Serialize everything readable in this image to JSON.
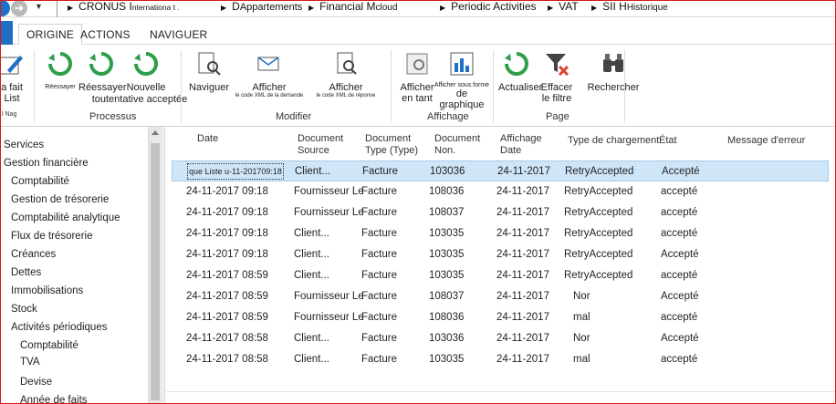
{
  "breadcrumb": {
    "company": "CRONUS I",
    "company_small": "nternationa t .",
    "dept": "D",
    "dept_small": "Appartements",
    "area": "Financial M",
    "area_small": "cloud",
    "periodic": "Periodic Activities",
    "vat": "VAT",
    "last": "SII H",
    "last_small": "Historique"
  },
  "tabs": [
    {
      "label": "ORIGINE"
    },
    {
      "label": "ACTIONS"
    },
    {
      "label": "NAVIGUER"
    }
  ],
  "ribbon": {
    "list_btn": {
      "line1": "a fait",
      "line2": "List",
      "small": "l Nag"
    },
    "retry": {
      "label": "Réessayer"
    },
    "retry_all": {
      "line1": "Réessayer",
      "line2": "toutentative acceptée"
    },
    "new_attempt": {
      "line1": "Nouvelle",
      "line2": ""
    },
    "naviguer": {
      "label": "Naviguer"
    },
    "show_request": {
      "line1": "Afficher",
      "line2": "le code XML de la demande"
    },
    "show_response": {
      "line1": "Afficher",
      "line2": "le code XML de réponse"
    },
    "show_list": {
      "line1": "Afficher",
      "line2": "en tant"
    },
    "show_chart": {
      "line1": "Afficher sous forme",
      "line2": "de graphique"
    },
    "refresh": {
      "label": "Actualiser"
    },
    "clear_filter": {
      "line1": "Effacer",
      "line2": "le filtre"
    },
    "search": {
      "label": "Rechercher"
    },
    "groups": {
      "processus": "Processus",
      "modifier": "Modifier",
      "affichage": "Affichage",
      "page": "Page"
    },
    "colors": {
      "refresh_green": "#2e9e4a",
      "blue": "#1f6fc5",
      "clear_red": "#d9452b"
    }
  },
  "sidebar": {
    "items": [
      {
        "label": "Services",
        "indent": 0
      },
      {
        "label": "Gestion financière",
        "indent": 0
      },
      {
        "label": "Comptabilité",
        "indent": 1
      },
      {
        "label": "Gestion de trésorerie",
        "indent": 1
      },
      {
        "label": "Comptabilité analytique",
        "indent": 1
      },
      {
        "label": "Flux de trésorerie",
        "indent": 1
      },
      {
        "label": "Créances",
        "indent": 1
      },
      {
        "label": "Dettes",
        "indent": 1
      },
      {
        "label": "Immobilisations",
        "indent": 1
      },
      {
        "label": "Stock",
        "indent": 1
      },
      {
        "label": "Activités périodiques",
        "indent": 1
      },
      {
        "label": "Comptabilité",
        "indent": 2
      },
      {
        "label": "TVA",
        "indent": 2
      },
      {
        "label": "Devise",
        "indent": 2
      },
      {
        "label": "Année de faits",
        "indent": 2
      }
    ]
  },
  "table": {
    "columns": [
      {
        "label": "Date"
      },
      {
        "label": "Document\nSource"
      },
      {
        "label": "Document\nType (Type)"
      },
      {
        "label": "Document\nNon."
      },
      {
        "label": "Affichage\nDate"
      },
      {
        "label": "Type de chargement"
      },
      {
        "label": "État"
      },
      {
        "label": "Message d'erreur"
      }
    ],
    "rows": [
      {
        "date": "que Liste u-11-201709:18",
        "source": "Client...",
        "doc_type": "Facture",
        "doc_no": "103036",
        "posting_date": "24-11-2017",
        "upload_type": "RetryAccepted",
        "state": "Accepté",
        "error": ""
      },
      {
        "date": "24-11-2017 09:18",
        "source": "Fournisseur Le",
        "doc_type": "Facture",
        "doc_no": "108036",
        "posting_date": "24-11-2017",
        "upload_type": "RetryAccepted",
        "state": "accepté",
        "error": ""
      },
      {
        "date": "24-11-2017 09:18",
        "source": "Fournisseur Le",
        "doc_type": "Facture",
        "doc_no": "108037",
        "posting_date": "24-11-2017",
        "upload_type": "RetryAccepted",
        "state": "accepté",
        "error": ""
      },
      {
        "date": "24-11-2017 09:18",
        "source": "Client...",
        "doc_type": "Facture",
        "doc_no": "103035",
        "posting_date": "24-11-2017",
        "upload_type": "RetryAccepted",
        "state": "accepté",
        "error": ""
      },
      {
        "date": "24-11-2017 09:18",
        "source": "Client...",
        "doc_type": "Facture",
        "doc_no": "103035",
        "posting_date": "24-11-2017",
        "upload_type": "RetryAccepted",
        "state": "Accepté",
        "error": ""
      },
      {
        "date": "24-11-2017 08:59",
        "source": "Client...",
        "doc_type": "Facture",
        "doc_no": "103035",
        "posting_date": "24-11-2017",
        "upload_type": "RetryAccepted",
        "state": "accepté",
        "error": ""
      },
      {
        "date": "24-11-2017 08:59",
        "source": "Fournisseur Le",
        "doc_type": "Facture",
        "doc_no": "108037",
        "posting_date": "24-11-2017",
        "upload_type": "Nor",
        "state": "Accepté",
        "error": ""
      },
      {
        "date": "24-11-2017 08:59",
        "source": "Fournisseur Le",
        "doc_type": "Facture",
        "doc_no": "108036",
        "posting_date": "24-11-2017",
        "upload_type": "mal",
        "state": "accepté",
        "error": ""
      },
      {
        "date": "24-11-2017 08:58",
        "source": "Client...",
        "doc_type": "Facture",
        "doc_no": "103036",
        "posting_date": "24-11-2017",
        "upload_type": "Nor",
        "state": "Accepté",
        "error": ""
      },
      {
        "date": "24-11-2017 08:58",
        "source": "Client...",
        "doc_type": "Facture",
        "doc_no": "103035",
        "posting_date": "24-11-2017",
        "upload_type": "mal",
        "state": "accepté",
        "error": ""
      }
    ]
  }
}
